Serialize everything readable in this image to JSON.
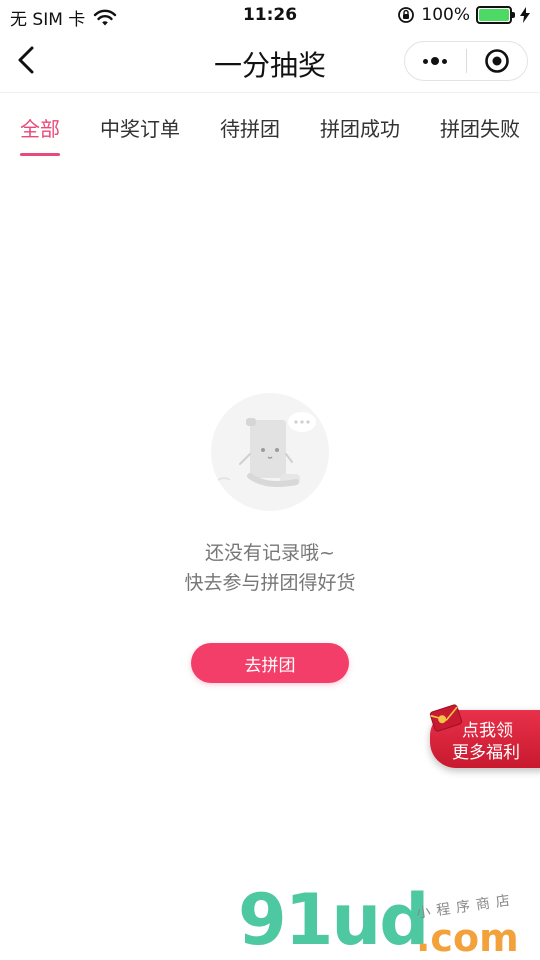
{
  "status_bar": {
    "carrier": "无 SIM 卡",
    "time": "11:26",
    "battery_percent": "100%",
    "battery_level": 1.0
  },
  "nav": {
    "title": "一分抽奖"
  },
  "tabs": [
    {
      "label": "全部",
      "active": true
    },
    {
      "label": "中奖订单",
      "active": false
    },
    {
      "label": "待拼团",
      "active": false
    },
    {
      "label": "拼团成功",
      "active": false
    },
    {
      "label": "拼团失败",
      "active": false
    }
  ],
  "empty_state": {
    "line1": "还没有记录哦~",
    "line2": "快去参与拼团得好货",
    "button_label": "去拼团"
  },
  "float_badge": {
    "line1": "点我领",
    "line2": "更多福利"
  },
  "watermark": {
    "main": "91ud",
    "suffix": ".com",
    "tagline": "小程序商店"
  },
  "colors": {
    "accent": "#e84a7a",
    "button": "#f23e68",
    "badge": "#d8243c",
    "watermark_green": "#4ec8a0",
    "watermark_orange": "#f3a13a"
  },
  "icons": {
    "back": "chevron-left-icon",
    "more": "more-dots-icon",
    "close": "target-icon"
  }
}
